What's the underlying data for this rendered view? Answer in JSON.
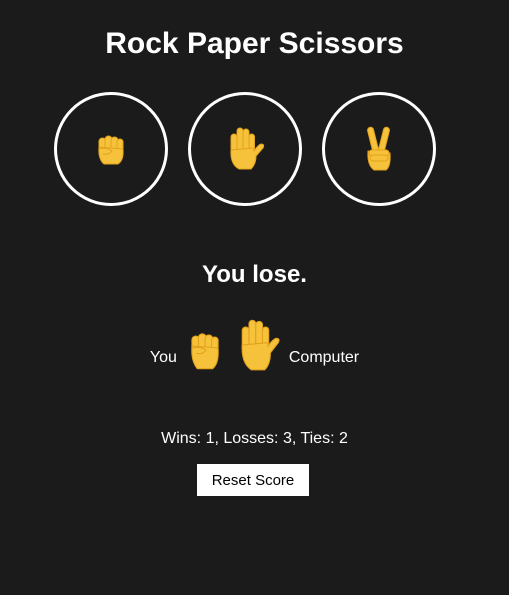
{
  "title": "Rock Paper Scissors",
  "choices": [
    {
      "name": "rock",
      "icon": "raised-fist-icon"
    },
    {
      "name": "paper",
      "icon": "raised-hand-icon"
    },
    {
      "name": "scissors",
      "icon": "victory-hand-icon"
    }
  ],
  "result": {
    "message": "You lose.",
    "player_label": "You",
    "computer_label": "Computer",
    "player_move_icon": "raised-fist-icon",
    "computer_move_icon": "raised-hand-icon"
  },
  "score": {
    "text": "Wins: 1, Losses: 3, Ties: 2",
    "wins": 1,
    "losses": 3,
    "ties": 2
  },
  "reset_label": "Reset Score",
  "colors": {
    "background": "#1b1b1b",
    "text": "#ffffff",
    "emoji_fill": "#f7c23b",
    "emoji_shade": "#e2a21a"
  }
}
